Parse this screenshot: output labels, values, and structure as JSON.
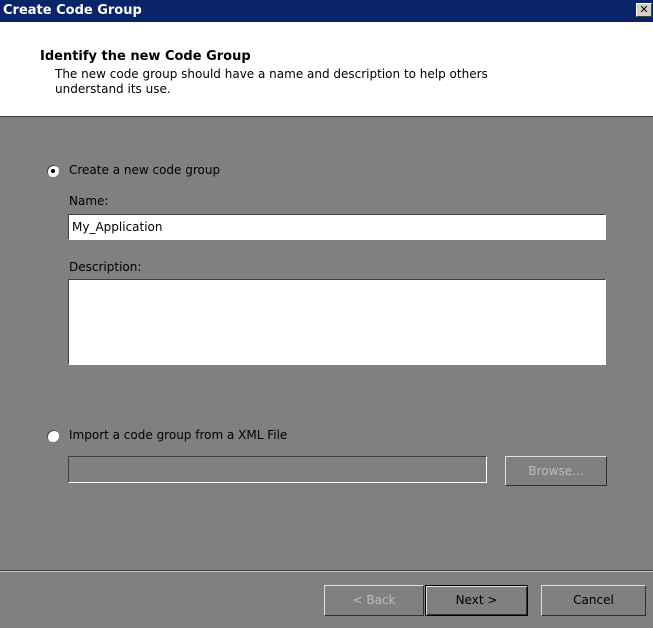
{
  "window": {
    "title": "Create Code Group",
    "close_glyph": "✕"
  },
  "header": {
    "title": "Identify the new Code Group",
    "description": "The new code group should have a name and description to help others understand its use."
  },
  "create_option": {
    "label": "Create a new code group",
    "selected": true,
    "name_label": "Name:",
    "name_value": "My_Application",
    "description_label": "Description:",
    "description_value": ""
  },
  "import_option": {
    "label": "Import a code group from a XML File",
    "selected": false,
    "path_value": "",
    "browse_label": "Browse..."
  },
  "footer": {
    "back_label": "< Back",
    "next_label": "Next >",
    "cancel_label": "Cancel"
  },
  "colors": {
    "title_bar": "#0a246a",
    "dialog_bg": "#808080",
    "header_bg": "#ffffff"
  }
}
